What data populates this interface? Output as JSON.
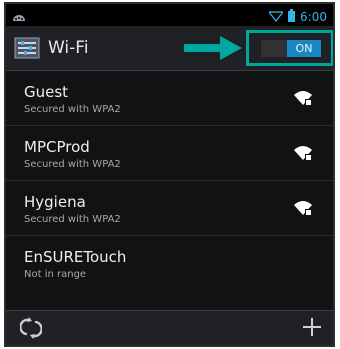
{
  "status_bar": {
    "time": "6:00"
  },
  "action_bar": {
    "title": "Wi-Fi",
    "toggle_label": "ON",
    "highlight_color": "#00a79d"
  },
  "networks": [
    {
      "ssid": "Guest",
      "status": "Secured with WPA2",
      "icon": "wifi-locked-icon"
    },
    {
      "ssid": "MPCProd",
      "status": "Secured with WPA2",
      "icon": "wifi-locked-icon"
    },
    {
      "ssid": "Hygiena",
      "status": "Secured with WPA2",
      "icon": "wifi-locked-icon"
    },
    {
      "ssid": "EnSURETouch",
      "status": "Not in range",
      "icon": ""
    }
  ],
  "bottom_bar": {
    "left_icon": "wps-icon",
    "right_icon": "add-network-icon"
  },
  "colors": {
    "accent": "#33b5e5",
    "toggle_on": "#1a86c2",
    "background": "#111214"
  }
}
